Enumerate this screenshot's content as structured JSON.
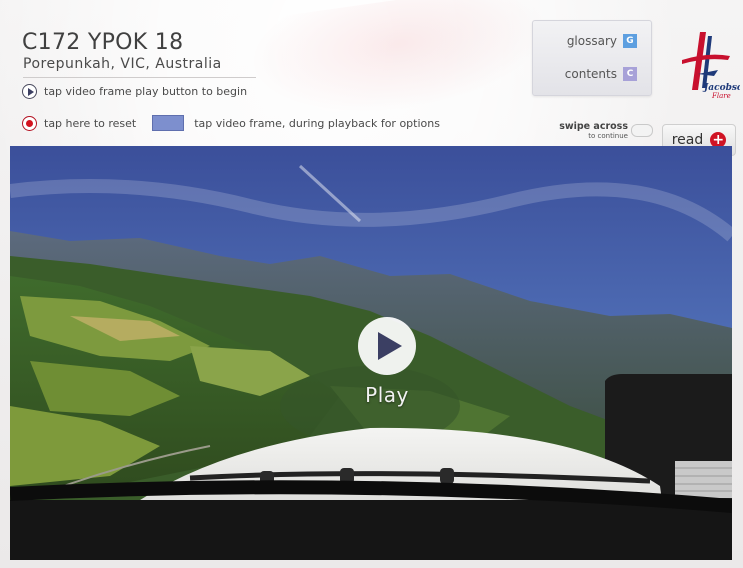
{
  "header": {
    "title": "C172 YPOK 18",
    "subtitle": "Porepunkah, VIC, Australia"
  },
  "hints": {
    "play": "tap video frame play button  to begin",
    "reset": "tap here to reset",
    "options": "tap video frame, during playback for options"
  },
  "nav": {
    "glossary": "glossary",
    "glossary_badge": "G",
    "contents": "contents",
    "contents_badge": "C"
  },
  "logo": {
    "line1": "Jacobson",
    "line2": "Flare"
  },
  "swipe": {
    "line1": "swipe across",
    "line2": "to continue"
  },
  "read_button": "read",
  "video": {
    "play_label": "Play"
  },
  "colors": {
    "accent_red": "#d01424",
    "accent_blue": "#7d8fce",
    "glossary_badge": "#5d9fe0",
    "contents_badge": "#a7a1d8"
  }
}
